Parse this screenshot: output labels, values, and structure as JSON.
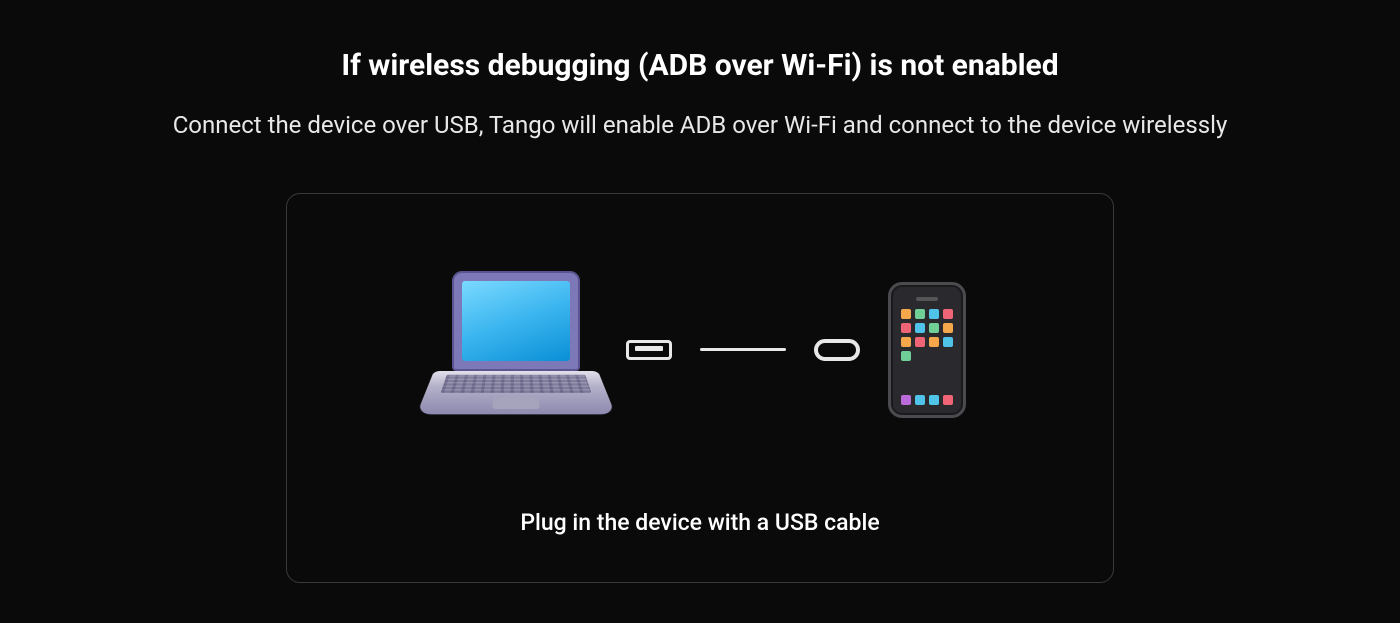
{
  "heading": "If wireless debugging (ADB over Wi-Fi) is not enabled",
  "subheading": "Connect the device over USB, Tango will enable ADB over Wi-Fi and connect to the device wirelessly",
  "card": {
    "caption": "Plug in the device with a USB cable"
  }
}
